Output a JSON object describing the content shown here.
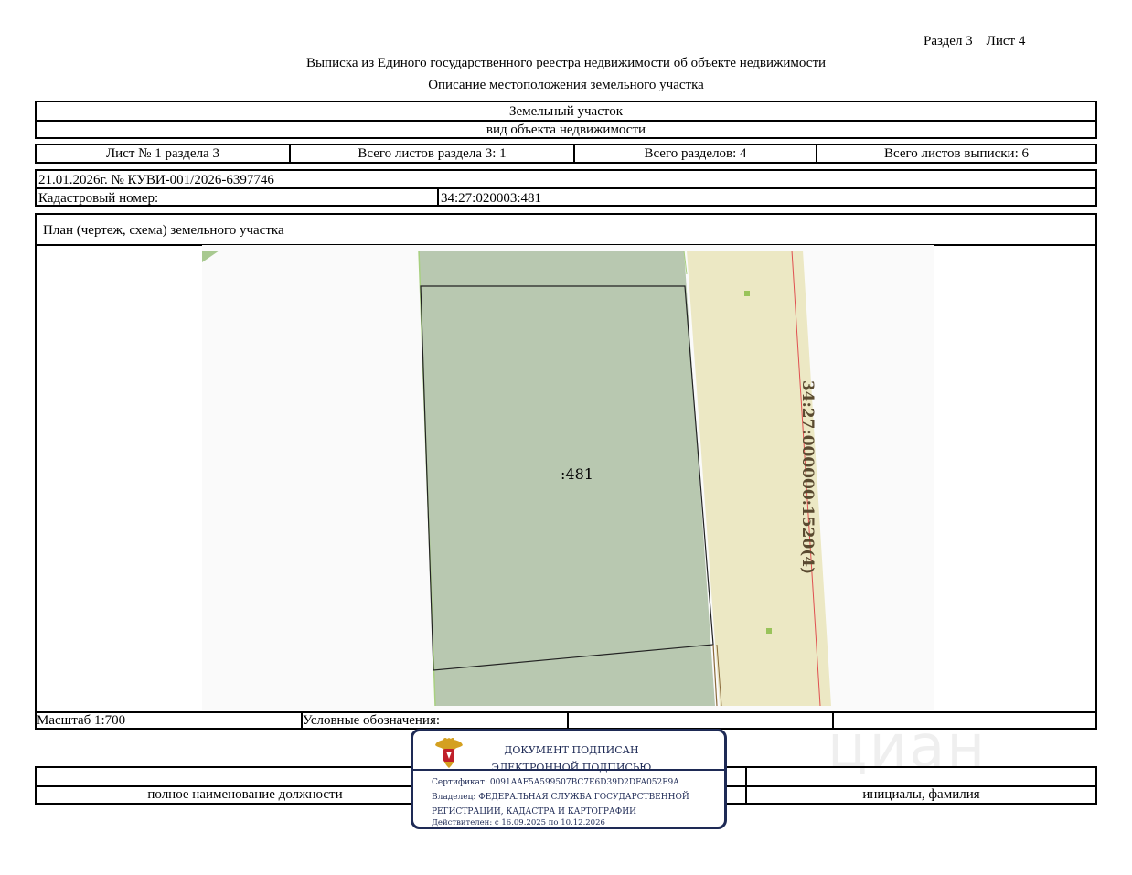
{
  "header": {
    "section_sheet": "Раздел 3    Лист 4",
    "title": "Выписка из Единого государственного реестра недвижимости об объекте недвижимости",
    "subtitle": "Описание местоположения земельного участка"
  },
  "object": {
    "kind": "Земельный участок",
    "kind_caption": "вид объекта недвижимости"
  },
  "sheets": {
    "sheet_of_section": "Лист № 1 раздела 3",
    "total_sheets_section": "Всего листов раздела 3: 1",
    "total_sections": "Всего разделов: 4",
    "total_sheets_extract": "Всего листов выписки: 6"
  },
  "registration": {
    "date_number": "21.01.2026г. № КУВИ-001/2026-6397746",
    "cadastral_label": "Кадастровый номер:",
    "cadastral_value": "34:27:020003:481"
  },
  "plan": {
    "title": "План (чертеж, схема) земельного участка",
    "parcel_label": ":481",
    "neighbor_label": "34:27:000000:1520(4)",
    "scale": "Масштаб 1:700",
    "legend_label": "Условные обозначения:",
    "colors": {
      "parcel_fill": "#b8c8b0",
      "neighbor_fill": "#ece8c4",
      "boundary_red": "#e05050",
      "marker_green": "#99c35a",
      "map_bg": "#fafafa"
    }
  },
  "signature_block": {
    "position_caption": "полное наименование должности",
    "name_caption": "инициалы, фамилия"
  },
  "stamp": {
    "line1": "ДОКУМЕНТ ПОДПИСАН",
    "line2": "ЭЛЕКТРОННОЙ ПОДПИСЬЮ",
    "certificate": "Сертификат: 0091AAF5A599507BC7E6D39D2DFA052F9A",
    "owner": "Владелец: ФЕДЕРАЛЬНАЯ СЛУЖБА ГОСУДАРСТВЕННОЙ",
    "owner_cont": "РЕГИСТРАЦИИ, КАДАСТРА И КАРТОГРАФИИ",
    "valid": "Действителен: с 16.09.2025 по 10.12.2026",
    "emblem_icon": "coat-of-arms-icon"
  },
  "watermark": "циан"
}
